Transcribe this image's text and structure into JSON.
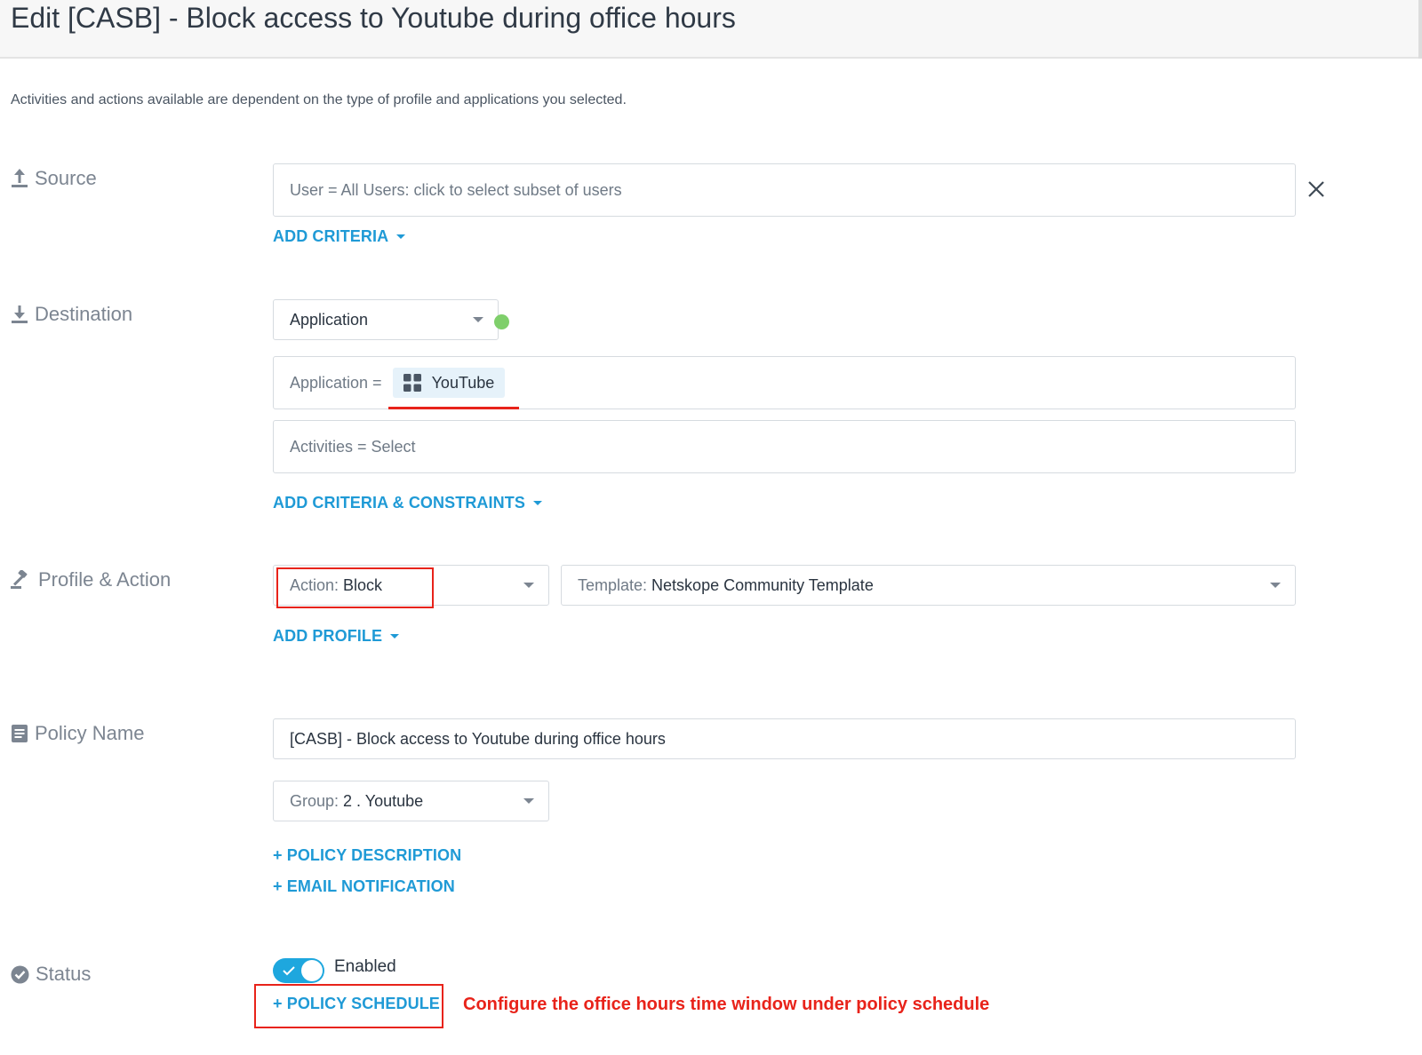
{
  "page": {
    "title": "Edit [CASB] - Block access to Youtube during office hours",
    "subtitle": "Activities and actions available are dependent on the type of profile and applications you selected."
  },
  "source": {
    "label": "Source",
    "user_field": "User = All Users: click to select subset of users",
    "add_criteria": "ADD CRITERIA"
  },
  "destination": {
    "label": "Destination",
    "type_select": "Application",
    "application_prefix": "Application =",
    "application_chip": "YouTube",
    "activities_field": "Activities = Select",
    "add_criteria": "ADD CRITERIA & CONSTRAINTS"
  },
  "profile_action": {
    "label": "Profile & Action",
    "action_prefix": "Action:",
    "action_value": "Block",
    "template_prefix": "Template:",
    "template_value": "Netskope Community Template",
    "add_profile": "ADD PROFILE"
  },
  "policy_name": {
    "label": "Policy Name",
    "name_value": "[CASB] - Block access to Youtube during office hours",
    "group_prefix": "Group:",
    "group_value": "2 . Youtube",
    "policy_description_link": "+ POLICY DESCRIPTION",
    "email_notification_link": "+ EMAIL NOTIFICATION"
  },
  "status": {
    "label": "Status",
    "toggle_label": "Enabled",
    "toggle_on": true,
    "policy_schedule_link": "+ POLICY SCHEDULE"
  },
  "annotation": {
    "text": "Configure the office hours time window under policy schedule",
    "color": "#e8231a"
  },
  "colors": {
    "accent": "#1f9ad6",
    "toggle": "#1ea7de",
    "status_dot": "#7fcf6b",
    "highlight": "#e8231a"
  }
}
